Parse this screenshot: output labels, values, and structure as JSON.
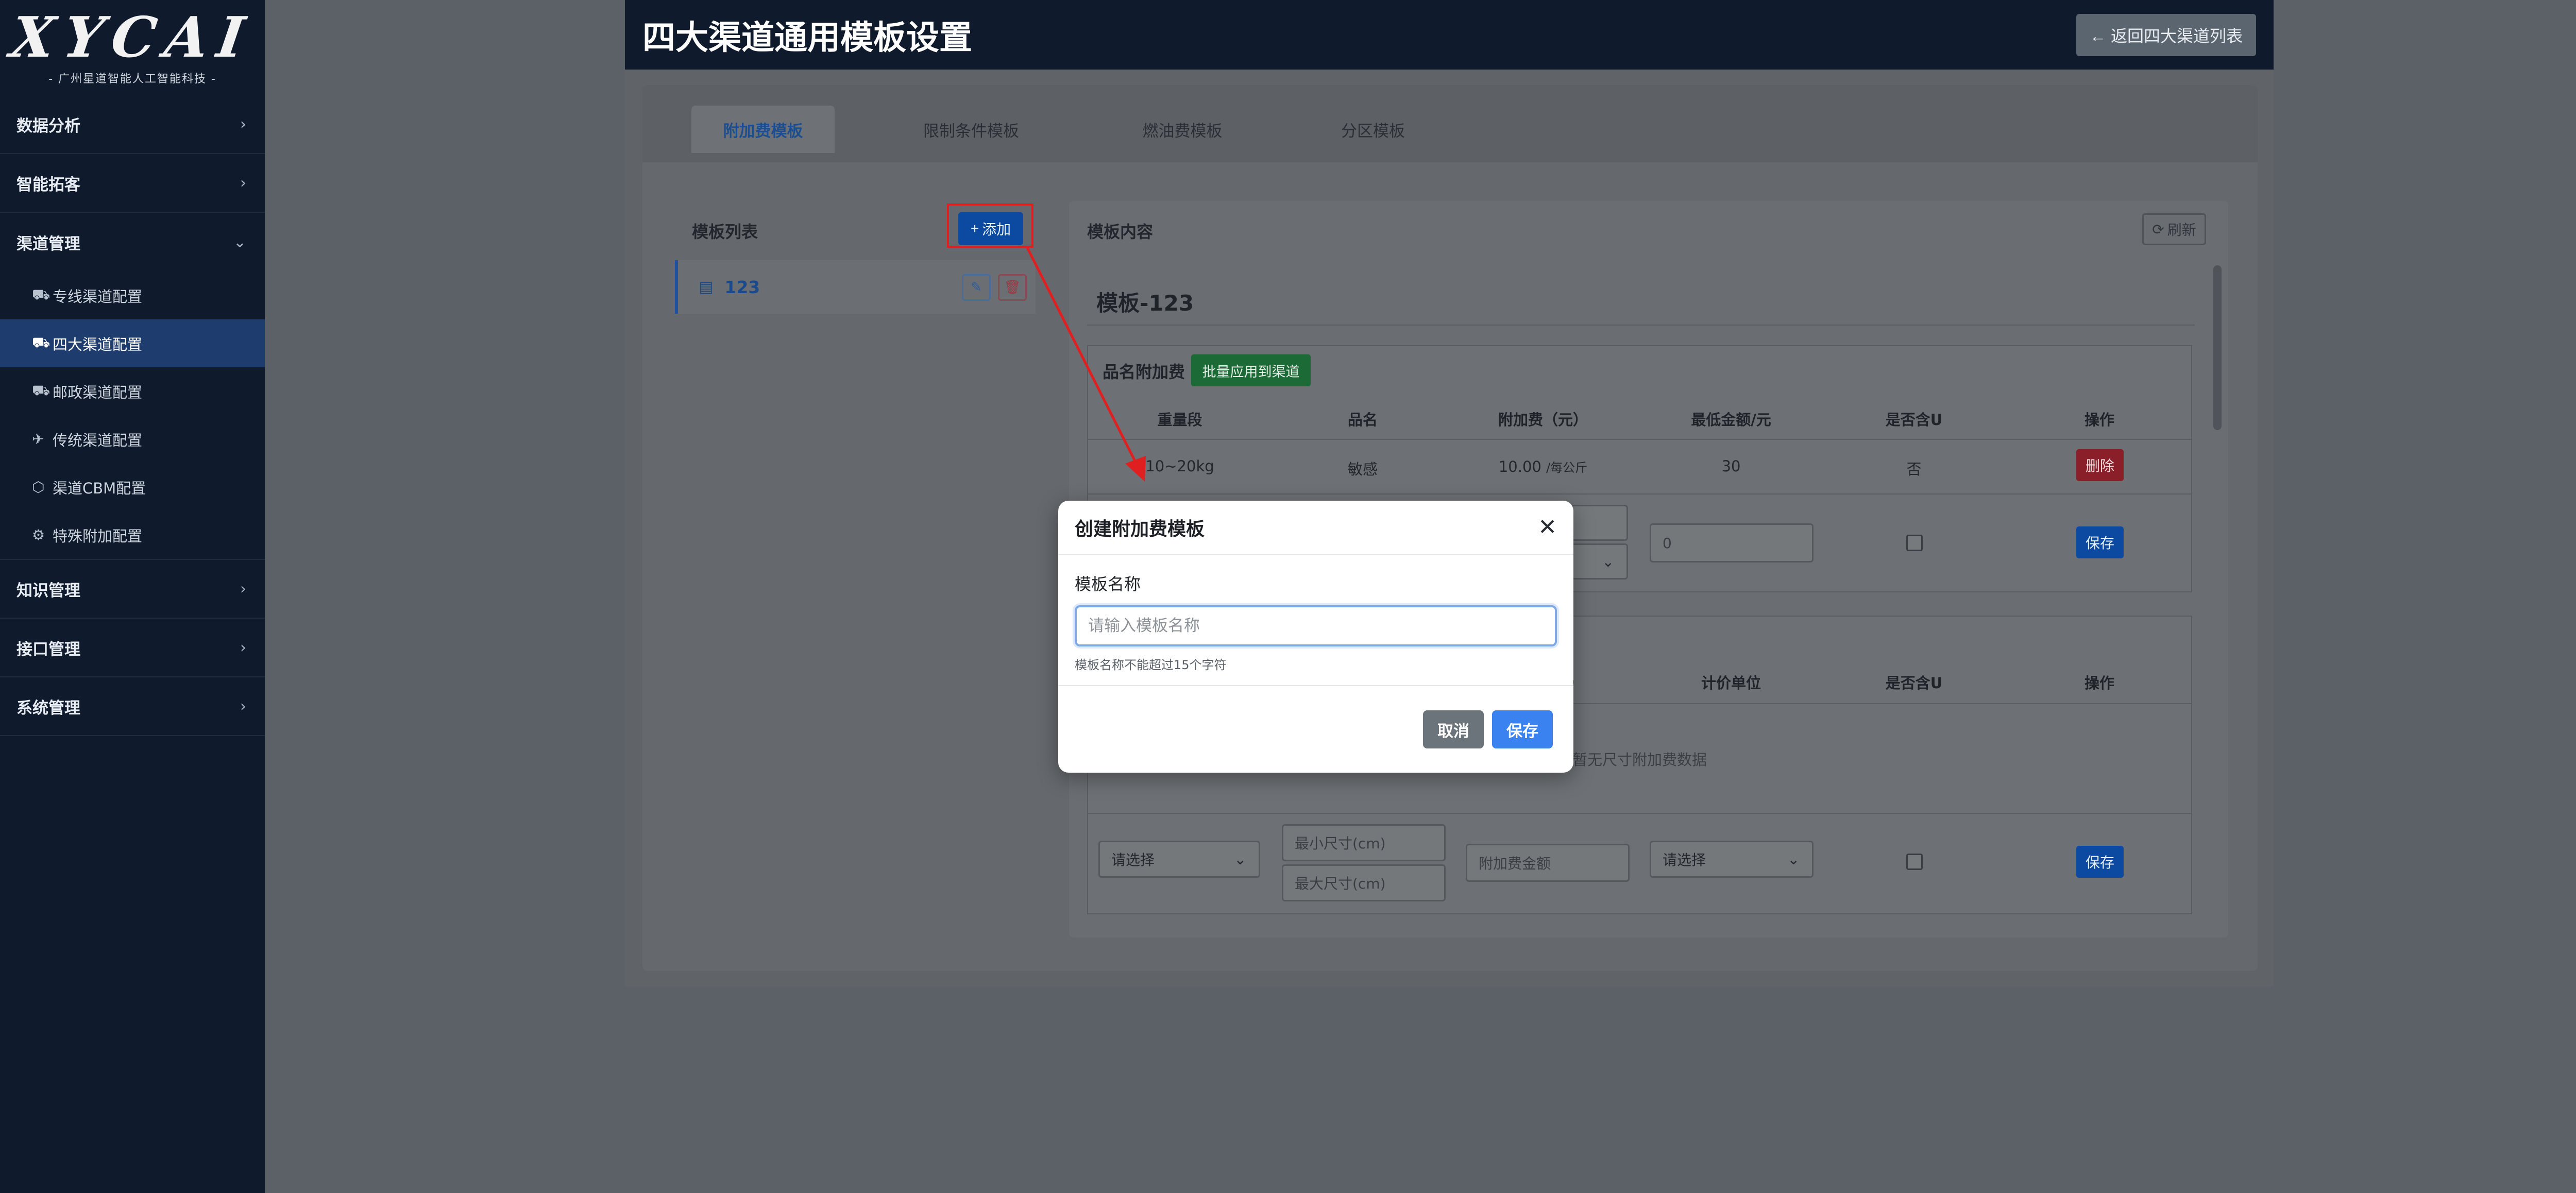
{
  "sidebar": {
    "logo_main": "XYCAI",
    "logo_sub": "- 广州星道智能人工智能科技 -",
    "sections": [
      {
        "label": "数据分析"
      },
      {
        "label": "智能拓客"
      },
      {
        "label": "渠道管理"
      },
      {
        "label": "知识管理"
      },
      {
        "label": "接口管理"
      },
      {
        "label": "系统管理"
      }
    ],
    "channel_items": [
      {
        "label": "专线渠道配置",
        "icon": "truck-icon"
      },
      {
        "label": "四大渠道配置",
        "icon": "truck-fast-icon",
        "active": true
      },
      {
        "label": "邮政渠道配置",
        "icon": "truck-icon"
      },
      {
        "label": "传统渠道配置",
        "icon": "plane-icon"
      },
      {
        "label": "渠道CBM配置",
        "icon": "cube-icon"
      },
      {
        "label": "特殊附加配置",
        "icon": "gear-icon"
      }
    ]
  },
  "header": {
    "title": "四大渠道通用模板设置",
    "back_label": "返回四大渠道列表"
  },
  "tabs": [
    "附加费模板",
    "限制条件模板",
    "燃油费模板",
    "分区模板"
  ],
  "template_list": {
    "title": "模板列表",
    "add_label": "添加",
    "items": [
      {
        "name": "123"
      }
    ]
  },
  "template_content": {
    "title": "模板内容",
    "refresh_label": "刷新",
    "template_name": "模板-123",
    "item_surcharge": {
      "title": "品名附加费",
      "batch_label": "批量应用到渠道",
      "headers": [
        "重量段",
        "品名",
        "附加费（元）",
        "最低金额/元",
        "是否含U",
        "操作"
      ],
      "rows": [
        {
          "weight": "10~20kg",
          "name": "敏感",
          "fee": "10.00",
          "fee_unit": "/每公斤",
          "min": "30",
          "include_u": "否",
          "action": "删除"
        }
      ],
      "new_row": {
        "min_value": "0",
        "save_label": "保存"
      }
    },
    "size_surcharge": {
      "headers_visible": [
        "计价单位",
        "是否含U",
        "操作"
      ],
      "header_fragment": "）",
      "empty_text": "暂无尺寸附加费数据",
      "new_row": {
        "select_placeholder": "请选择",
        "min_size_placeholder": "最小尺寸(cm)",
        "max_size_placeholder": "最大尺寸(cm)",
        "fee_placeholder": "附加费金额",
        "unit_placeholder": "请选择",
        "save_label": "保存"
      }
    }
  },
  "modal": {
    "title": "创建附加费模板",
    "field_label": "模板名称",
    "input_placeholder": "请输入模板名称",
    "input_value": "",
    "hint": "模板名称不能超过15个字符",
    "cancel_label": "取消",
    "save_label": "保存"
  },
  "colors": {
    "sidebar_bg": "#0f1b2d",
    "primary": "#3a82f0",
    "annotation_red": "#e02020"
  }
}
